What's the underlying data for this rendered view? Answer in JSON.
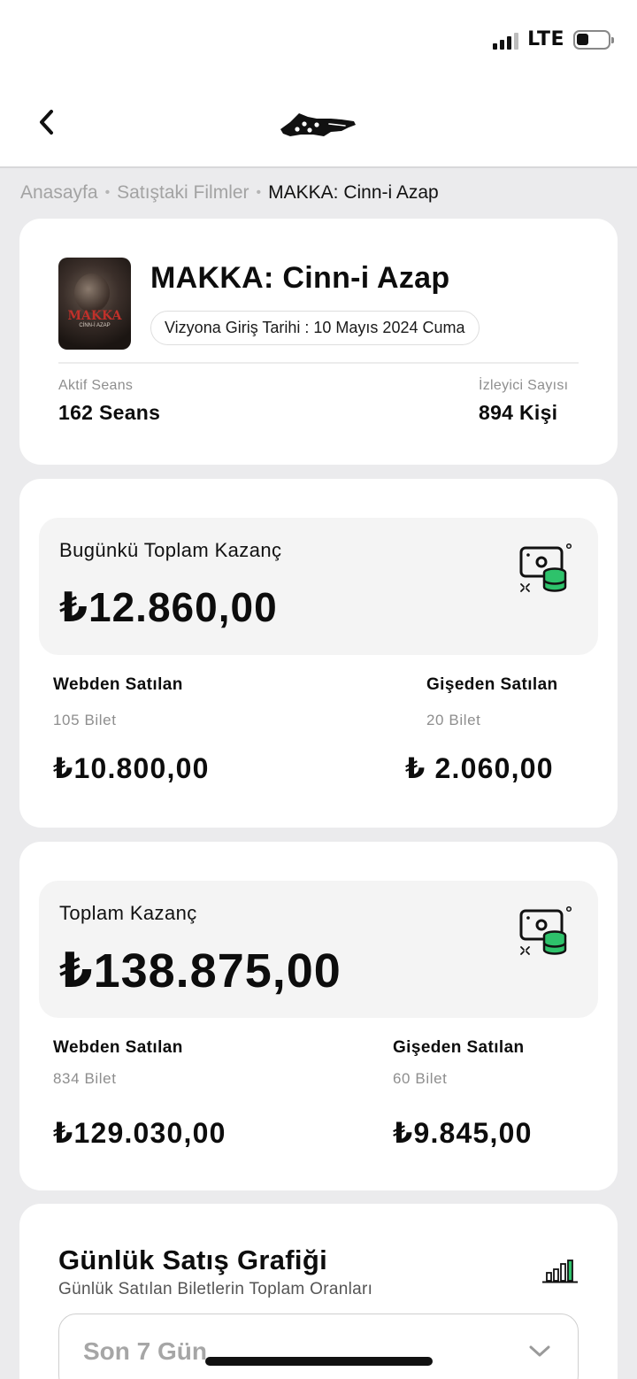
{
  "status_bar": {
    "network": "LTE",
    "signal_bars": 3,
    "signal_bars_total": 4,
    "battery_percent": 40
  },
  "nav": {
    "back_icon": "chevron-left-icon",
    "logo_icon": "ticket-logo-icon"
  },
  "breadcrumb": {
    "items": [
      "Anasayfa",
      "Satıştaki Filmler"
    ],
    "separator": "•",
    "current": "MAKKA: Cinn-i Azap"
  },
  "movie": {
    "title": "MAKKA: Cinn-i Azap",
    "poster_title": "MAKKA",
    "poster_subtitle": "CİNN-İ AZAP",
    "release_label": "Vizyona Giriş Tarihi : 10 Mayıs 2024 Cuma",
    "active_sessions_label": "Aktif Seans",
    "active_sessions_value": "162 Seans",
    "viewers_label": "İzleyici Sayısı",
    "viewers_value": "894 Kişi"
  },
  "today": {
    "label": "Bugünkü Toplam Kazanç",
    "amount": "₺12.860,00",
    "web": {
      "title": "Webden Satılan",
      "count": "105 Bilet",
      "amount": "₺10.800,00"
    },
    "box": {
      "title": "Gişeden Satılan",
      "count": "20 Bilet",
      "amount": "₺ 2.060,00"
    }
  },
  "total": {
    "label": "Toplam Kazanç",
    "amount": "₺138.875,00",
    "web": {
      "title": "Webden Satılan",
      "count": "834 Bilet",
      "amount": "₺129.030,00"
    },
    "box": {
      "title": "Gişeden Satılan",
      "count": "60 Bilet",
      "amount": "₺9.845,00"
    }
  },
  "daily_chart": {
    "title": "Günlük Satış Grafiği",
    "subtitle": "Günlük Satılan Biletlerin Toplam Oranları",
    "icon": "bar-chart-icon",
    "period_select": "Son 7 Gün"
  },
  "colors": {
    "accent_green": "#2ec26b",
    "background": "#ebebed",
    "card": "#ffffff",
    "muted": "#8e8e8e"
  }
}
